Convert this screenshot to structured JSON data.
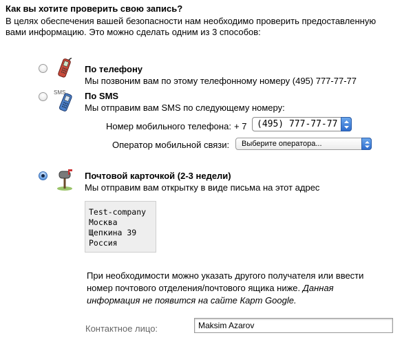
{
  "heading": "Как вы хотите проверить свою запись?",
  "intro": "В целях обеспечения вашей безопасности нам необходимо проверить предоставленную вами информацию. Это можно сделать одним из 3 способов:",
  "options": [
    {
      "title": "По телефону",
      "desc": "Мы позвоним вам по этому телефонному номеру (495) 777-77-77",
      "selected": false,
      "icon": "mobile-phone-icon"
    },
    {
      "title": "По SMS",
      "desc": "Мы отправим вам SMS по следующему номеру:",
      "selected": false,
      "icon": "sms-phone-icon",
      "icon_text": "SMS",
      "phone_label": "Номер мобильного телефона:",
      "phone_prefix": "+ 7",
      "phone_value": "(495) 777-77-77",
      "operator_label": "Оператор мобильной связи:",
      "operator_value": "Выберите оператора..."
    },
    {
      "title": "Почтовой карточкой (2-3 недели)",
      "desc": "Мы отправим вам открытку в виде письма на этот адрес",
      "selected": true,
      "icon": "mailbox-icon"
    }
  ],
  "address_lines": [
    "Test-company",
    "Москва",
    "Щепкина 39",
    "Россия"
  ],
  "note": "При необходимости можно указать другого получателя или ввести номер почтового отделения/почтового ящика ниже.",
  "note_italic": "Данная информация не появится на сайте Карт Google.",
  "contact_label": "Контактное лицо:",
  "contact_value": "Maksim Azarov",
  "colors": {
    "radio_selected": "#3a79c9",
    "address_bg": "#eeeeee"
  }
}
